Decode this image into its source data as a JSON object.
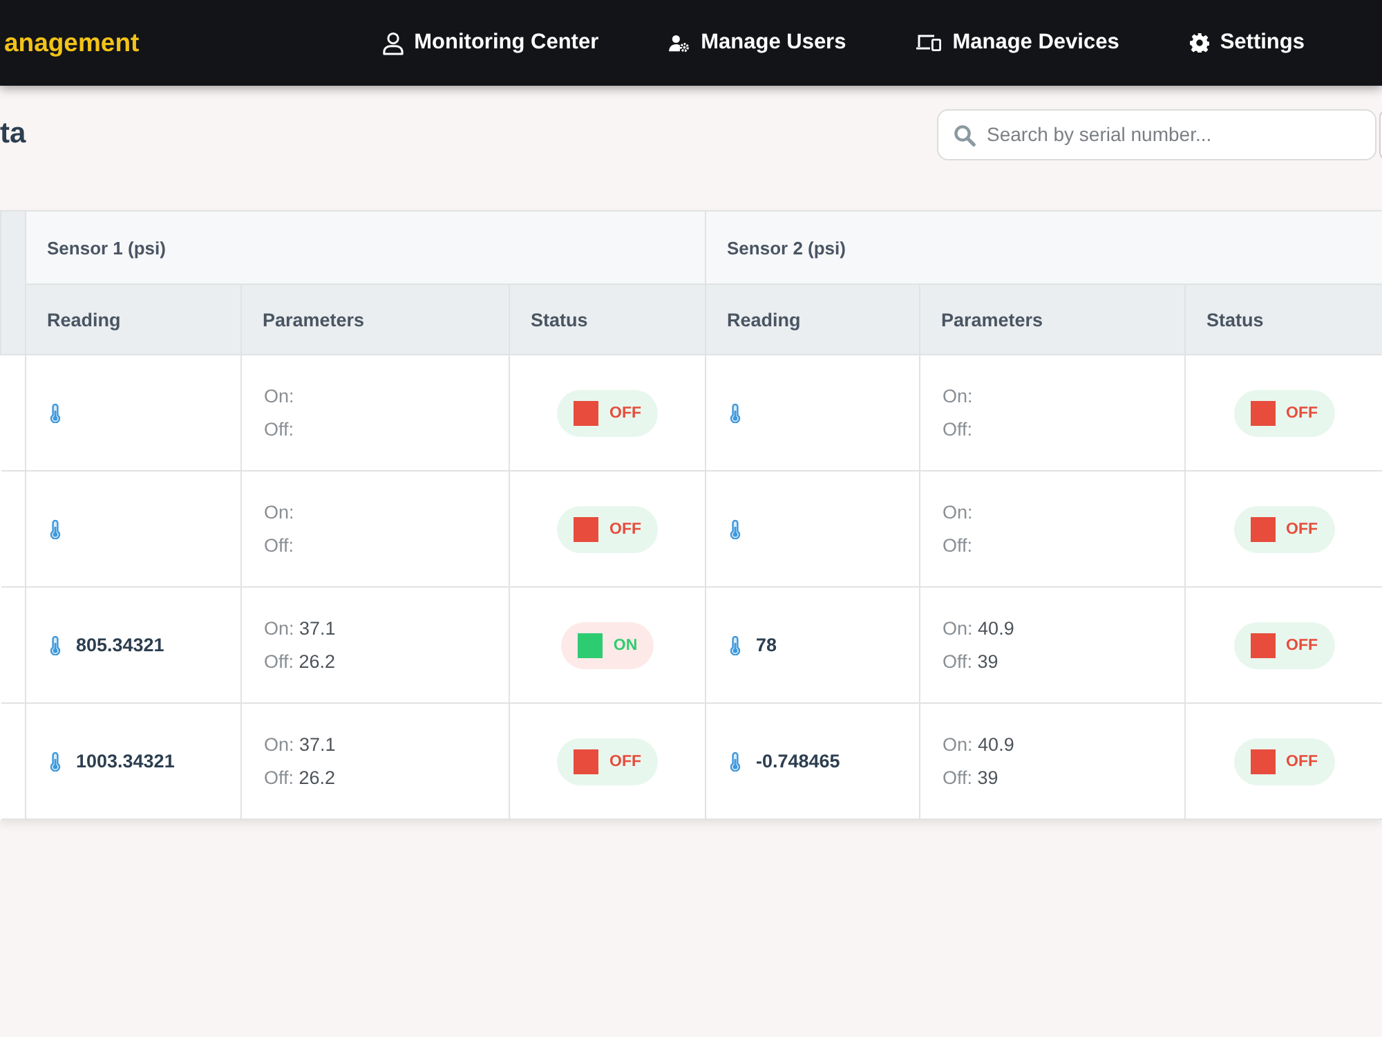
{
  "navbar": {
    "brand": "anagement",
    "items": [
      {
        "label": "Monitoring Center",
        "kind": "person"
      },
      {
        "label": "Manage Users",
        "kind": "usergear"
      },
      {
        "label": "Manage Devices",
        "kind": "devices"
      },
      {
        "label": "Settings",
        "kind": "gear"
      }
    ]
  },
  "header": {
    "title": "ta",
    "search": {
      "placeholder": "Search by serial number..."
    }
  },
  "table": {
    "sensors": [
      {
        "title": "Sensor 1 (psi)",
        "columns": [
          "Reading",
          "Parameters",
          "Status"
        ]
      },
      {
        "title": "Sensor 2 (psi)",
        "columns": [
          "Reading",
          "Parameters",
          "Status"
        ]
      }
    ],
    "rows": [
      {
        "sensors": [
          {
            "parameters": [
              {
                "label": "On:"
              },
              {
                "label": "Off:"
              }
            ],
            "status": {
              "label": "OFF",
              "color": "#e74c3c"
            }
          },
          {
            "parameters": [
              {
                "label": "On:"
              },
              {
                "label": "Off:"
              }
            ],
            "status": {
              "label": "OFF",
              "color": "#e74c3c"
            }
          }
        ]
      },
      {
        "sensors": [
          {
            "parameters": [
              {
                "label": "On:"
              },
              {
                "label": "Off:"
              }
            ],
            "status": {
              "label": "OFF",
              "color": "#e74c3c"
            }
          },
          {
            "parameters": [
              {
                "label": "On:"
              },
              {
                "label": "Off:"
              }
            ],
            "status": {
              "label": "OFF",
              "color": "#e74c3c"
            }
          }
        ]
      },
      {
        "sensors": [
          {
            "reading": "805.34321",
            "parameters": [
              {
                "label": "On:",
                "value": "37.1"
              },
              {
                "label": "Off:",
                "value": "26.2"
              }
            ],
            "status": {
              "label": "ON",
              "color": "#2ecc71"
            }
          },
          {
            "reading": "78",
            "parameters": [
              {
                "label": "On:",
                "value": "40.9"
              },
              {
                "label": "Off:",
                "value": "39"
              }
            ],
            "status": {
              "label": "OFF",
              "color": "#e74c3c"
            }
          }
        ]
      },
      {
        "sensors": [
          {
            "reading": "1003.34321",
            "parameters": [
              {
                "label": "On:",
                "value": "37.1"
              },
              {
                "label": "Off:",
                "value": "26.2"
              }
            ],
            "status": {
              "label": "OFF",
              "color": "#e74c3c"
            }
          },
          {
            "reading": "-0.748465",
            "parameters": [
              {
                "label": "On:",
                "value": "40.9"
              },
              {
                "label": "Off:",
                "value": "39"
              }
            ],
            "status": {
              "label": "OFF",
              "color": "#e74c3c"
            }
          }
        ]
      }
    ]
  }
}
